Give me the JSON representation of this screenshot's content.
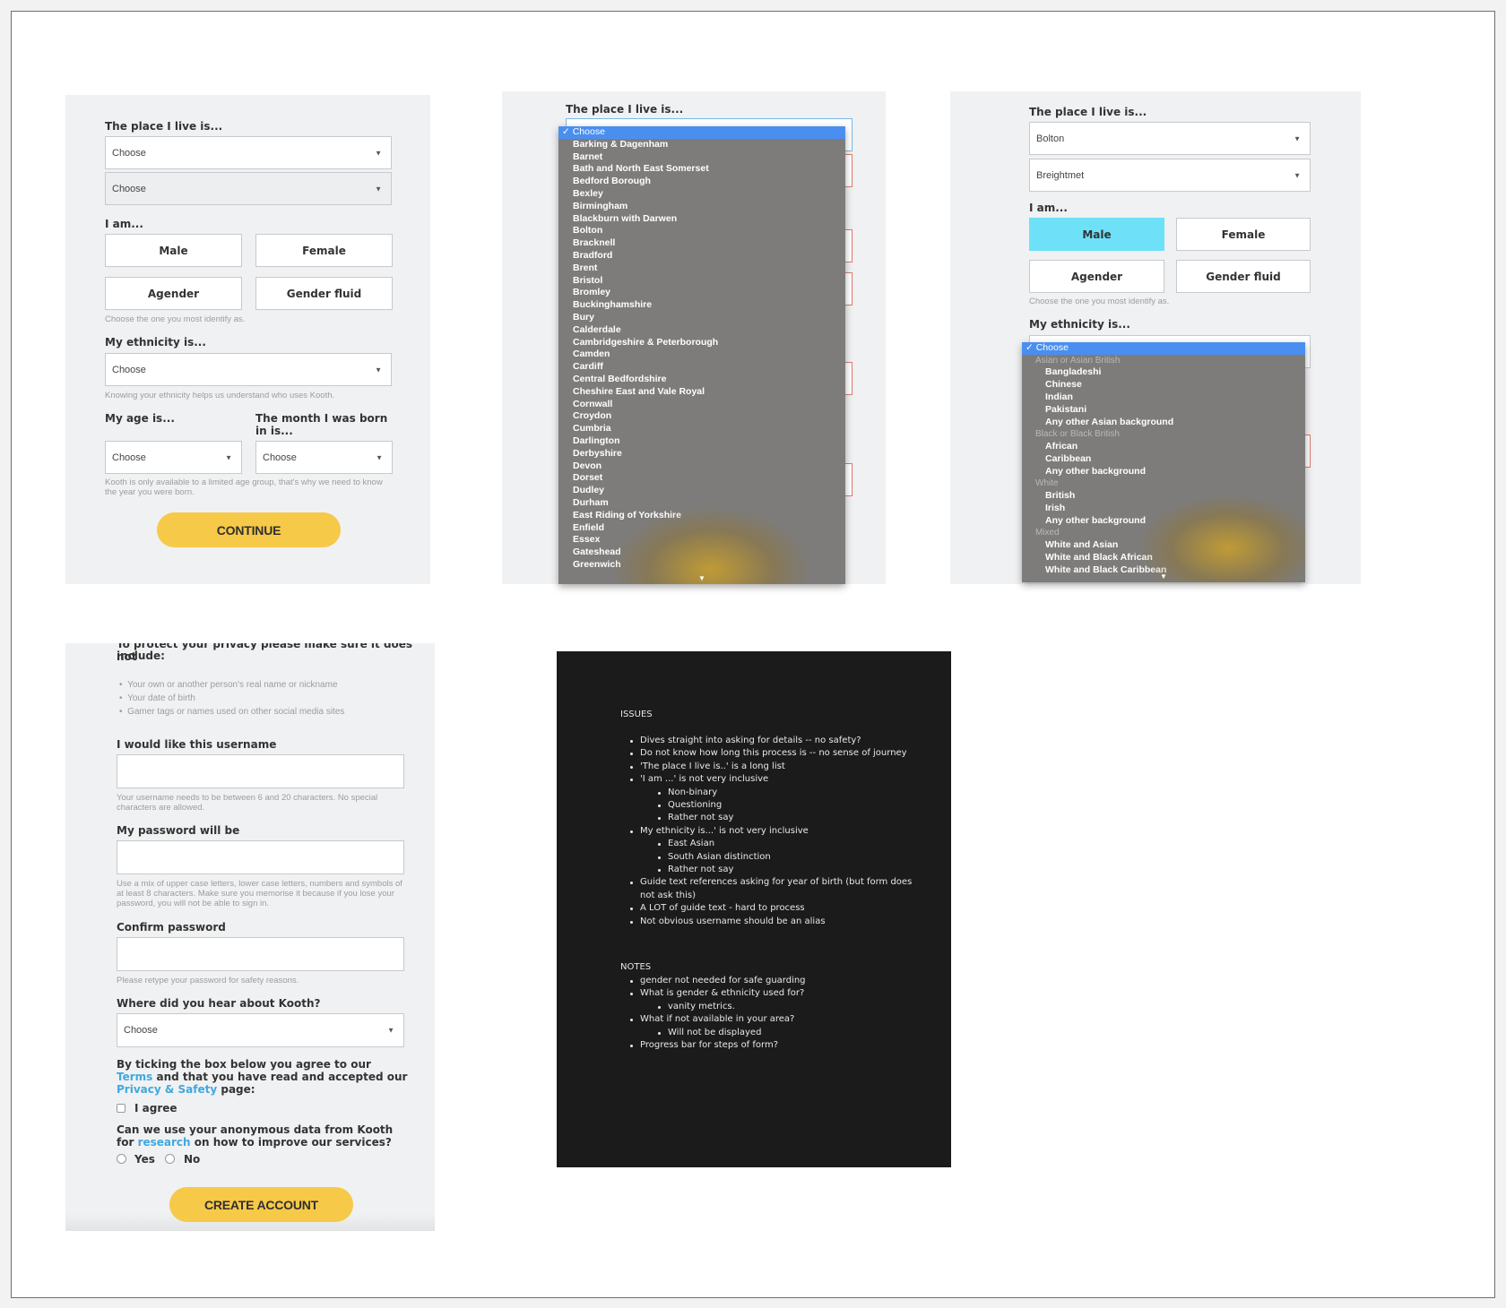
{
  "panel1": {
    "place_label": "The place I live is...",
    "place_value": "Choose",
    "place2_value": "Choose",
    "iam_label": "I am...",
    "genders": [
      "Male",
      "Female",
      "Agender",
      "Gender fluid"
    ],
    "gender_hint": "Choose the one you most identify as.",
    "ethnicity_label": "My ethnicity is...",
    "ethnicity_value": "Choose",
    "ethnicity_hint": "Knowing your ethnicity helps us understand who uses Kooth.",
    "age_label": "My age is...",
    "month_label": "The month I was born in is...",
    "age_value": "Choose",
    "month_value": "Choose",
    "age_hint": "Kooth is only available to a limited age group, that's why we need to know the year you were born.",
    "continue_label": "CONTINUE"
  },
  "panel2": {
    "place_label": "The place I live is...",
    "options": [
      "Choose",
      "Barking & Dagenham",
      "Barnet",
      "Bath and North East Somerset",
      "Bedford Borough",
      "Bexley",
      "Birmingham",
      "Blackburn with Darwen",
      "Bolton",
      "Bracknell",
      "Bradford",
      "Brent",
      "Bristol",
      "Bromley",
      "Buckinghamshire",
      "Bury",
      "Calderdale",
      "Cambridgeshire & Peterborough",
      "Camden",
      "Cardiff",
      "Central Bedfordshire",
      "Cheshire East and Vale Royal",
      "Cornwall",
      "Croydon",
      "Cumbria",
      "Darlington",
      "Derbyshire",
      "Devon",
      "Dorset",
      "Dudley",
      "Durham",
      "East Riding of Yorkshire",
      "Enfield",
      "Essex",
      "Gateshead",
      "Greenwich"
    ]
  },
  "panel3": {
    "place_label": "The place I live is...",
    "place_value": "Bolton",
    "place2_value": "Breightmet",
    "iam_label": "I am...",
    "genders": [
      "Male",
      "Female",
      "Agender",
      "Gender fluid"
    ],
    "gender_hint": "Choose the one you most identify as.",
    "ethnicity_label": "My ethnicity is...",
    "options": [
      {
        "text": "Choose",
        "kind": "active"
      },
      {
        "text": "Asian or Asian British",
        "kind": "group"
      },
      {
        "text": "Bangladeshi",
        "kind": "item"
      },
      {
        "text": "Chinese",
        "kind": "item"
      },
      {
        "text": "Indian",
        "kind": "item"
      },
      {
        "text": "Pakistani",
        "kind": "item"
      },
      {
        "text": "Any other Asian background",
        "kind": "item"
      },
      {
        "text": "Black or Black British",
        "kind": "group"
      },
      {
        "text": "African",
        "kind": "item"
      },
      {
        "text": "Caribbean",
        "kind": "item"
      },
      {
        "text": "Any other background",
        "kind": "item"
      },
      {
        "text": "White",
        "kind": "group"
      },
      {
        "text": "British",
        "kind": "item"
      },
      {
        "text": "Irish",
        "kind": "item"
      },
      {
        "text": "Any other background",
        "kind": "item"
      },
      {
        "text": "Mixed",
        "kind": "group"
      },
      {
        "text": "White and Asian",
        "kind": "item"
      },
      {
        "text": "White and Black African",
        "kind": "item"
      },
      {
        "text": "White and Black Caribbean",
        "kind": "item"
      }
    ]
  },
  "panel4": {
    "privacy_partial": "To protect your privacy please make sure it does not",
    "privacy_include": "include:",
    "bullets": [
      "Your own or another person's real name or nickname",
      "Your date of birth",
      "Gamer tags or names used on other social media sites"
    ],
    "username_label": "I would like this username",
    "username_value": "",
    "username_hint": "Your username needs to be between 6 and 20 characters. No special characters are allowed.",
    "password_label": "My password will be",
    "password_value": "",
    "password_hint": "Use a mix of upper case letters, lower case letters, numbers and symbols of at least 8 characters. Make sure you memorise it because if you lose your password, you will not be able to sign in.",
    "confirm_label": "Confirm password",
    "confirm_value": "",
    "confirm_hint": "Please retype your password for safety reasons.",
    "hear_label": "Where did you hear about Kooth?",
    "hear_value": "Choose",
    "terms_1": "By ticking the box below you agree to our ",
    "terms_link": "Terms",
    "terms_2": " and that you have read and accepted our ",
    "privacy_link": "Privacy & Safety",
    "terms_3": " page:",
    "agree_label": "I agree",
    "research_1": "Can we use your anonymous data from Kooth for ",
    "research_link": "research",
    "research_2": " on how to improve our services?",
    "yes_label": "Yes",
    "no_label": "No",
    "create_label": "CREATE ACCOUNT"
  },
  "notes": {
    "issues_heading": "ISSUES",
    "issues": [
      {
        "text": "Dives straight into asking for details -- no safety?",
        "level": 1
      },
      {
        "text": "Do not know how long this process is -- no sense of journey",
        "level": 1
      },
      {
        "text": "'The place I live is..' is a long list",
        "level": 1
      },
      {
        "text": "'I am ...' is not very inclusive",
        "level": 1
      },
      {
        "text": "Non-binary",
        "level": 2
      },
      {
        "text": "Questioning",
        "level": 2
      },
      {
        "text": "Rather not say",
        "level": 2
      },
      {
        "text": "My ethnicity is...' is not very inclusive",
        "level": 1
      },
      {
        "text": "East Asian",
        "level": 2
      },
      {
        "text": "South Asian distinction",
        "level": 2
      },
      {
        "text": "Rather not say",
        "level": 2
      },
      {
        "text": "Guide text references asking for year of birth (but form does",
        "level": 1
      },
      {
        "text": "not ask this)",
        "level": 0
      },
      {
        "text": "A LOT of guide text - hard to process",
        "level": 1
      },
      {
        "text": "Not obvious username should be an alias",
        "level": 1
      }
    ],
    "notes_heading": "NOTES",
    "notes": [
      {
        "text": "gender not needed for safe guarding",
        "level": 1
      },
      {
        "text": "What is gender & ethnicity used for?",
        "level": 1
      },
      {
        "text": "vanity metrics.",
        "level": 2
      },
      {
        "text": "What if not available in your area?",
        "level": 1
      },
      {
        "text": "Will not be displayed",
        "level": 2
      },
      {
        "text": "Progress bar for steps of form?",
        "level": 1
      }
    ]
  }
}
